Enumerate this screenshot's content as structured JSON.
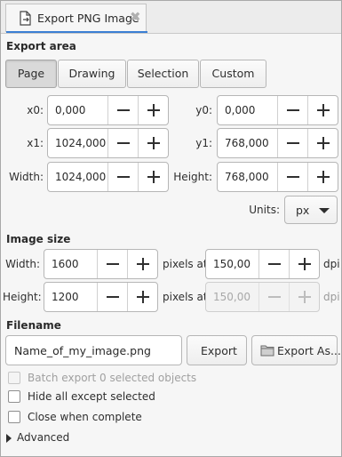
{
  "tab": {
    "title": "Export PNG Image",
    "icon": "export-document-icon",
    "close_icon": "close-icon"
  },
  "export_area": {
    "title": "Export area",
    "modes": [
      "Page",
      "Drawing",
      "Selection",
      "Custom"
    ],
    "active_mode": "Page",
    "x0": {
      "label": "x0:",
      "value": "0,000"
    },
    "y0": {
      "label": "y0:",
      "value": "0,000"
    },
    "x1": {
      "label": "x1:",
      "value": "1024,000"
    },
    "y1": {
      "label": "y1:",
      "value": "768,000"
    },
    "width": {
      "label": "Width:",
      "value": "1024,000"
    },
    "height": {
      "label": "Height:",
      "value": "768,000"
    },
    "units": {
      "label": "Units:",
      "value": "px"
    }
  },
  "image_size": {
    "title": "Image size",
    "width": {
      "label": "Width:",
      "value": "1600"
    },
    "height": {
      "label": "Height:",
      "value": "1200"
    },
    "dpi_x": {
      "label": "pixels at",
      "value": "150,00",
      "unit": "dpi"
    },
    "dpi_y": {
      "label": "pixels at",
      "value": "150,00",
      "unit": "dpi",
      "disabled": true
    }
  },
  "filename": {
    "title": "Filename",
    "value": "Name_of_my_image.png",
    "export_label": "Export",
    "export_as_label": "Export As...",
    "export_as_icon": "folder-icon"
  },
  "options": {
    "batch_export": {
      "label": "Batch export 0 selected objects",
      "checked": false,
      "disabled": true
    },
    "hide_all": {
      "label": "Hide all except selected",
      "checked": false
    },
    "close_when_complete": {
      "label": "Close when complete",
      "checked": false
    },
    "advanced": {
      "label": "Advanced",
      "expanded": false
    }
  },
  "colors": {
    "accent": "#3b7fd4"
  }
}
